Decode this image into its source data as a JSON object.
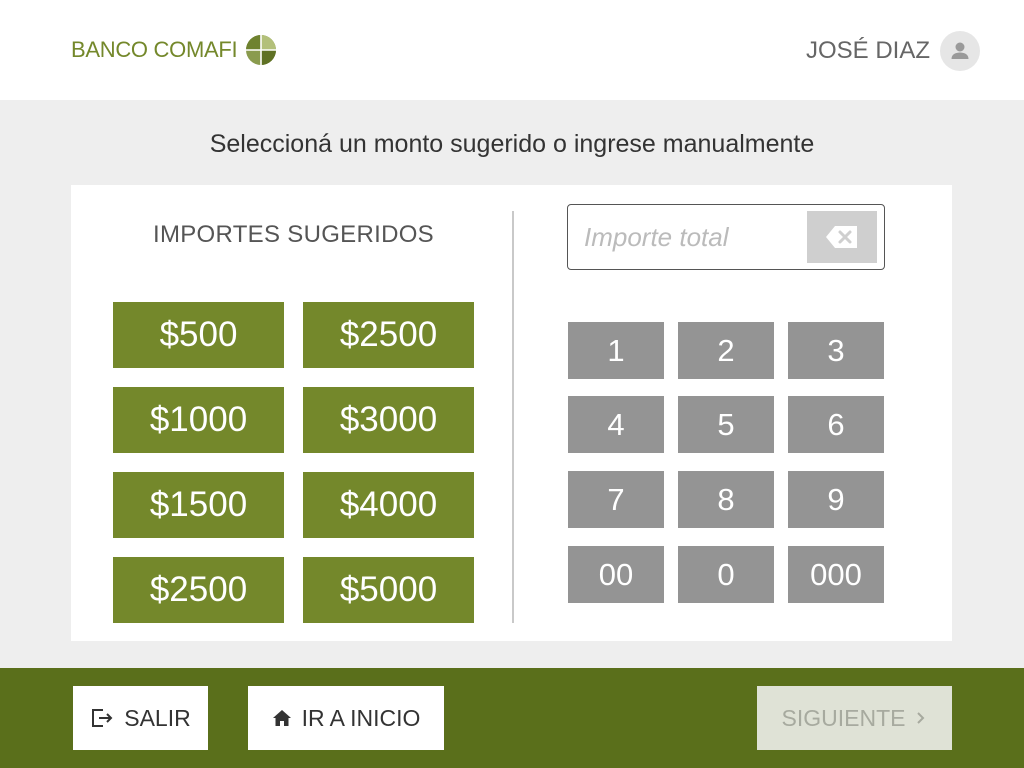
{
  "header": {
    "brand_name": "BANCO COMAFI",
    "user_name": "JOSÉ DIAZ"
  },
  "instruction": "Seleccioná un monto sugerido o ingrese manualmente",
  "suggested": {
    "title": "IMPORTES SUGERIDOS",
    "amounts": [
      "$500",
      "$2500",
      "$1000",
      "$3000",
      "$1500",
      "$4000",
      "$2500",
      "$5000"
    ]
  },
  "amount_input": {
    "value": "",
    "placeholder": "Importe total"
  },
  "keypad": {
    "keys": [
      "1",
      "2",
      "3",
      "4",
      "5",
      "6",
      "7",
      "8",
      "9",
      "00",
      "0",
      "000"
    ]
  },
  "footer": {
    "exit_label": "SALIR",
    "home_label": "IR A INICIO",
    "next_label": "SIGUIENTE"
  },
  "colors": {
    "brand_green": "#74882b",
    "footer_green": "#5a6f1b",
    "key_gray": "#949494"
  },
  "icons": {
    "logo": "globe-logo-icon",
    "user": "user-icon",
    "backspace": "backspace-icon",
    "exit": "exit-icon",
    "home": "home-icon",
    "next": "chevron-right-icon"
  }
}
